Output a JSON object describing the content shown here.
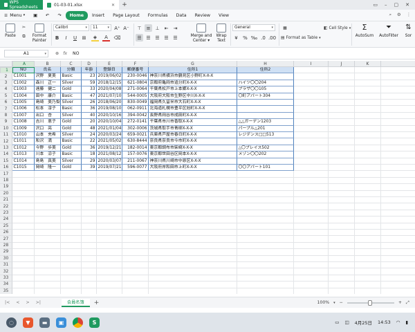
{
  "titlebar": {
    "app_tab": "WPS Spreadsheets",
    "file_tab": "01-03-01.xlsx",
    "new_tab": "+",
    "controls": [
      "▭",
      "–",
      "▢",
      "✕"
    ]
  },
  "menubar": {
    "menu_label": "Menu",
    "items": [
      "Home",
      "Insert",
      "Page Layout",
      "Formulas",
      "Data",
      "Review",
      "View"
    ],
    "active": "Home"
  },
  "ribbon": {
    "paste": "Paste",
    "format_painter_1": "Format",
    "format_painter_2": "Painter",
    "font_name": "Calibri",
    "font_size": "11",
    "merge_1": "Merge and",
    "merge_2": "Center",
    "wrap_1": "Wrap",
    "wrap_2": "Text",
    "number_format": "General",
    "format_as_table": "Format as Table",
    "cell_style": "Cell Style",
    "autosum": "AutoSum",
    "autofilter": "AutoFilter",
    "sort": "Sor"
  },
  "formula_bar": {
    "name_box": "A1",
    "fx": "fx",
    "value": "NO"
  },
  "columns": [
    "A",
    "B",
    "C",
    "D",
    "E",
    "F",
    "G",
    "H",
    "I",
    "J",
    "K"
  ],
  "rows": [
    "1",
    "2",
    "3",
    "4",
    "5",
    "6",
    "7",
    "8",
    "9",
    "10",
    "11",
    "12",
    "13",
    "14",
    "15",
    "16",
    "17",
    "18",
    "19",
    "20",
    "21",
    "22",
    "23",
    "24",
    "25",
    "26",
    "27",
    "28",
    "29",
    "30",
    "31",
    "32",
    "33",
    "34",
    "35"
  ],
  "table": {
    "headers": [
      "NO",
      "氏名",
      "分類",
      "年齢",
      "登録日",
      "郵便番号",
      "住所1",
      "住所2"
    ],
    "records": [
      [
        "C1001",
        "沢野　夏美",
        "Basic",
        "23",
        "2019/06/02",
        "230-0046",
        "神奈川県横浜市鶴見区小野町X-X-X",
        ""
      ],
      [
        "C1002",
        "森川　正一",
        "Silver",
        "59",
        "2018/12/15",
        "621-0804",
        "京都府亀岡市追分町X-X-X",
        "ハイツ〇〇204"
      ],
      [
        "C1003",
        "遠藤　健二",
        "Gold",
        "33",
        "2020/04/08",
        "271-0064",
        "千葉県松戸市上本郷X-X-X",
        "プラザ〇〇105"
      ],
      [
        "C1004",
        "田中　康介",
        "Basic",
        "47",
        "2021/07/10",
        "544-0005",
        "大阪府大阪市生野区中川X-X-X",
        "〇町アパート304"
      ],
      [
        "C1005",
        "島崎　美乃梨",
        "Silver",
        "26",
        "2018/06/20",
        "830-0049",
        "福岡県久留米市大石町X-X-X",
        ""
      ],
      [
        "C1006",
        "松本　淳子",
        "Basic",
        "36",
        "2019/08/10",
        "062-0911",
        "北海道札幌市豊平区旭町X-X-X",
        ""
      ],
      [
        "C1007",
        "出口　杏",
        "Silver",
        "40",
        "2020/10/16",
        "394-0042",
        "長野県岡谷市成田町X-X-X",
        ""
      ],
      [
        "C1008",
        "吉川　恵子",
        "Gold",
        "20",
        "2020/10/04",
        "272-0141",
        "千葉県市川市香取X-X-X",
        "△△ガーデン1203"
      ],
      [
        "C1009",
        "沢口　亮",
        "Gold",
        "48",
        "2021/01/04",
        "302-0006",
        "茨城県取手市青柳X-X-X",
        "パープル△201"
      ],
      [
        "C1010",
        "山本　充希",
        "Silver",
        "24",
        "2020/03/24",
        "659-0021",
        "兵庫県芦屋市春日町X-X-X",
        "レジデンス□□513"
      ],
      [
        "C1011",
        "和沢　満",
        "Basic",
        "22",
        "2021/05/02",
        "630-8444",
        "奈良県奈良市今市町X-X-X",
        ""
      ],
      [
        "C1012",
        "今野　歩美",
        "Gold",
        "36",
        "2019/12/21",
        "182-0014",
        "東京都調布市柴崎X-X-X",
        "△〇プレイス502"
      ],
      [
        "C1013",
        "川本　涼子",
        "Basic",
        "18",
        "2021/08/12",
        "157-0076",
        "東京都世田谷区岡本X-X-X",
        "メゾン〇〇202"
      ],
      [
        "C1014",
        "島島　真美",
        "Silver",
        "29",
        "2020/03/07",
        "211-0067",
        "神奈川県川崎市中原区X-X-X",
        ""
      ],
      [
        "C1015",
        "岡崎　隆一",
        "Gold",
        "39",
        "2019/07/21",
        "596-0077",
        "大阪府岸和田市上町X-X-X",
        "〇〇アパート101"
      ]
    ]
  },
  "sheetbar": {
    "nav": [
      "|<",
      "<",
      ">",
      ">|"
    ],
    "sheet_name": "会員名簿",
    "add": "+",
    "zoom": "100%",
    "zoom_level_percent": 100
  },
  "taskbar": {
    "date": "4月25日",
    "time": "14:53"
  },
  "colors": {
    "brand": "#1f9a5f",
    "header_fill": "#cfe0f4",
    "table_border": "#4f81bd"
  }
}
